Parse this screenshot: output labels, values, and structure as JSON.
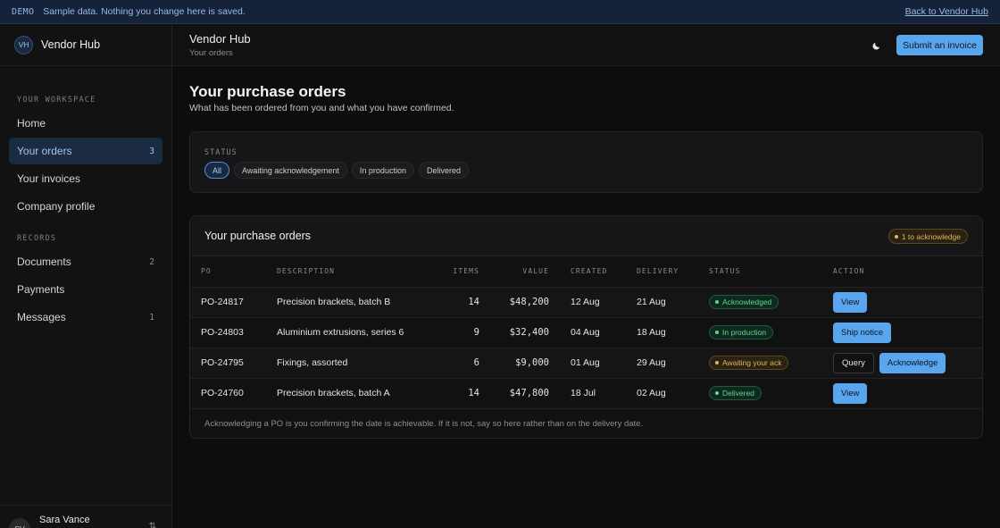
{
  "banner": {
    "tag": "DEMO",
    "message": "Sample data. Nothing you change here is saved.",
    "back_link": "Back to Vendor Hub"
  },
  "sidebar": {
    "brand_initials": "VH",
    "brand_name": "Vendor Hub",
    "workspace_label": "YOUR WORKSPACE",
    "workspace_items": [
      {
        "label": "Home",
        "count": ""
      },
      {
        "label": "Your orders",
        "count": "3"
      },
      {
        "label": "Your invoices",
        "count": ""
      },
      {
        "label": "Company profile",
        "count": ""
      }
    ],
    "records_label": "RECORDS",
    "records_items": [
      {
        "label": "Documents",
        "count": "2"
      },
      {
        "label": "Payments",
        "count": ""
      },
      {
        "label": "Messages",
        "count": "1"
      }
    ],
    "user": {
      "initials": "SV",
      "name": "Sara Vance",
      "switch_glyph": "⇅"
    }
  },
  "header": {
    "title": "Vendor Hub",
    "subtitle": "Your orders",
    "submit_label": "Submit an invoice"
  },
  "page": {
    "title": "Your purchase orders",
    "lead": "What has been ordered from you and what you have confirmed."
  },
  "filters": {
    "label": "STATUS",
    "options": [
      "All",
      "Awaiting acknowledgement",
      "In production",
      "Delivered"
    ],
    "selected": "All"
  },
  "orders": {
    "title": "Your purchase orders",
    "badge": "1 to acknowledge",
    "columns": [
      "PO",
      "DESCRIPTION",
      "ITEMS",
      "VALUE",
      "CREATED",
      "DELIVERY",
      "STATUS",
      "ACTION"
    ],
    "rows": [
      {
        "po": "PO-24817",
        "description": "Precision brackets, batch B",
        "items": "14",
        "value": "$48,200",
        "created": "12 Aug",
        "delivery": "21 Aug",
        "status": "Acknowledged",
        "tone": "green",
        "actions": [
          {
            "label": "View",
            "kind": "primary"
          }
        ]
      },
      {
        "po": "PO-24803",
        "description": "Aluminium extrusions, series 6",
        "items": "9",
        "value": "$32,400",
        "created": "04 Aug",
        "delivery": "18 Aug",
        "status": "In production",
        "tone": "green",
        "actions": [
          {
            "label": "Ship notice",
            "kind": "primary"
          }
        ]
      },
      {
        "po": "PO-24795",
        "description": "Fixings, assorted",
        "items": "6",
        "value": "$9,000",
        "created": "01 Aug",
        "delivery": "29 Aug",
        "status": "Awaiting your ack",
        "tone": "amber",
        "actions": [
          {
            "label": "Query",
            "kind": "ghost"
          },
          {
            "label": "Acknowledge",
            "kind": "primary"
          }
        ]
      },
      {
        "po": "PO-24760",
        "description": "Precision brackets, batch A",
        "items": "14",
        "value": "$47,800",
        "created": "18 Jul",
        "delivery": "02 Aug",
        "status": "Delivered",
        "tone": "green",
        "actions": [
          {
            "label": "View",
            "kind": "primary"
          }
        ]
      }
    ],
    "footnote": "Acknowledging a PO is you confirming the date is achievable. If it is not, say so here rather than on the delivery date."
  },
  "colors": {
    "accent": "#5aa6ee",
    "green_text": "#5fd49a",
    "amber_text": "#e3b558"
  }
}
